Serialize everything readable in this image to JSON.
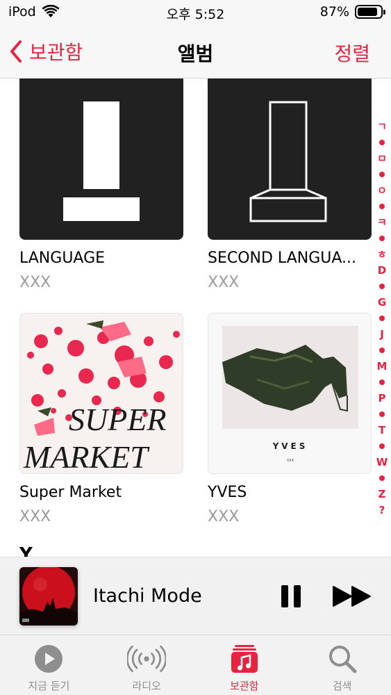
{
  "status_bar": {
    "carrier": "iPod",
    "time": "오후 5:52",
    "battery_percent": "87%",
    "battery_level": 0.87
  },
  "nav": {
    "back_label": "보관함",
    "title": "앨범",
    "sort_label": "정렬"
  },
  "albums": [
    {
      "title": "LANGUAGE",
      "artist": "XXX",
      "cover": "black-minimal-monument"
    },
    {
      "title": "SECOND LANGUA...",
      "artist": "XXX",
      "cover": "black-outline-monument"
    },
    {
      "title": "Super Market",
      "artist": "XXX",
      "cover": "watermelon-splatter",
      "cover_text": [
        "SUPER",
        "MARKET"
      ]
    },
    {
      "title": "YVES",
      "artist": "XXX",
      "cover": "green-dress",
      "cover_text": [
        "YVES",
        "XXX"
      ]
    }
  ],
  "section_header": "Y",
  "index_bar": [
    "ㄱ",
    "•",
    "ㅁ",
    "•",
    "ㅇ",
    "•",
    "ㅋ",
    "•",
    "ㅎ",
    "D",
    "•",
    "G",
    "•",
    "J",
    "•",
    "M",
    "•",
    "P",
    "•",
    "T",
    "•",
    "W",
    "•",
    "Z",
    "?"
  ],
  "mini_player": {
    "title": "Itachi Mode",
    "artwork": "red-moon-artwork",
    "controls": [
      "pause-icon",
      "fast-forward-icon"
    ]
  },
  "tabs": [
    {
      "label": "지금 듣기",
      "icon": "play-circle-icon",
      "active": false
    },
    {
      "label": "라디오",
      "icon": "radio-broadcast-icon",
      "active": false
    },
    {
      "label": "보관함",
      "icon": "library-music-icon",
      "active": true
    },
    {
      "label": "검색",
      "icon": "search-icon",
      "active": false
    }
  ],
  "colors": {
    "accent": "#e6243f",
    "secondary_text": "#9a9a9a",
    "inactive_tab": "#8e8e8e"
  }
}
